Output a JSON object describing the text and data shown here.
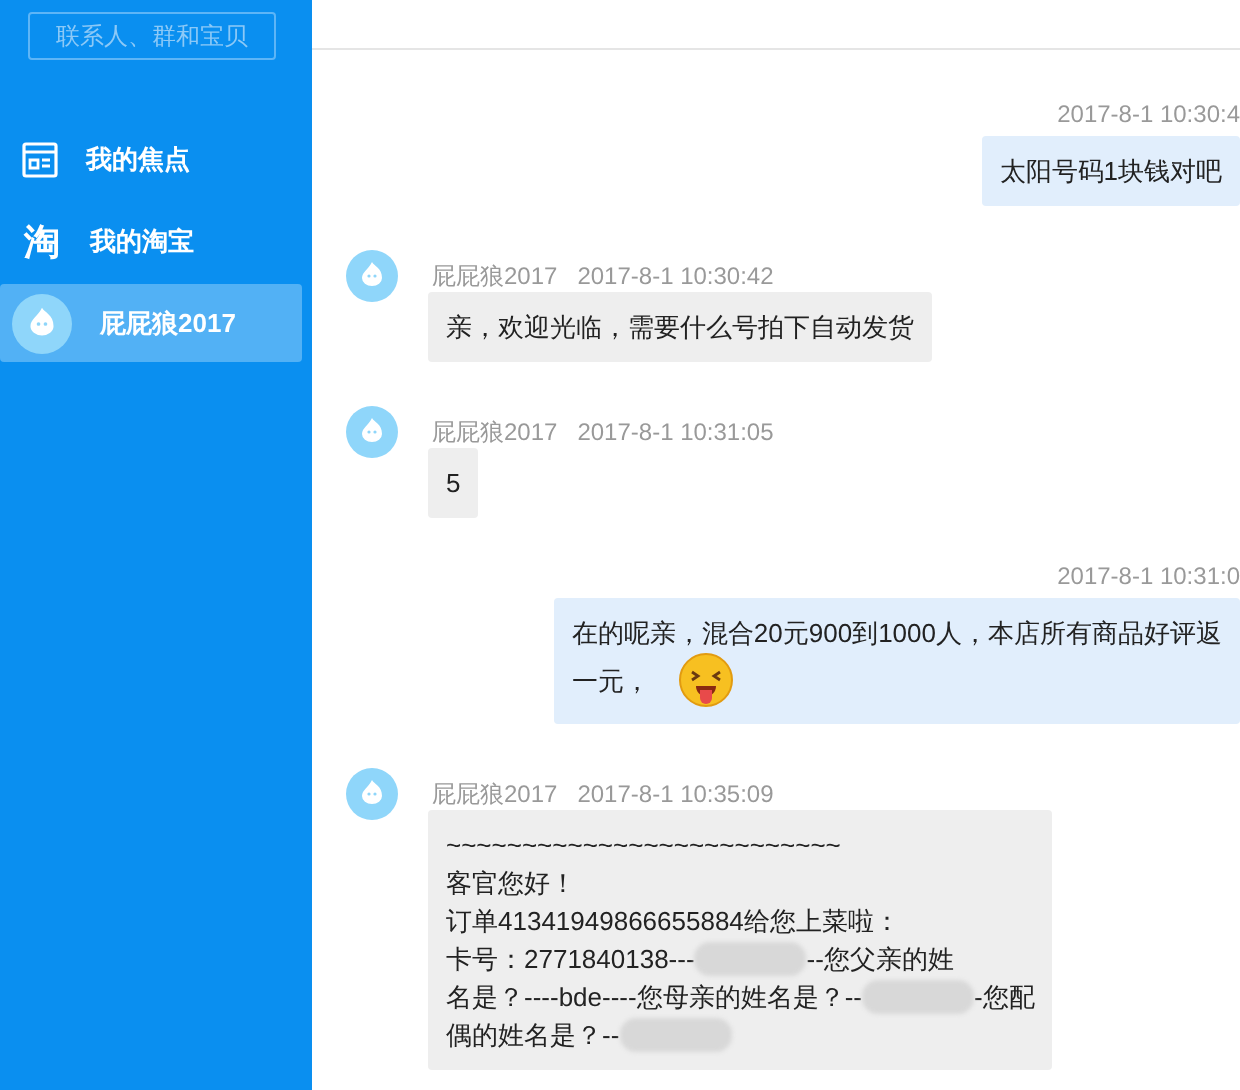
{
  "sidebar": {
    "search": {
      "placeholder": "联系人、群和宝贝"
    },
    "items": [
      {
        "kind": "news",
        "label": "我的焦点",
        "selected": false
      },
      {
        "kind": "taobao",
        "icon_text": "淘",
        "label": "我的淘宝",
        "selected": false
      },
      {
        "kind": "contact",
        "label": "屁屁狼2017",
        "selected": true
      }
    ]
  },
  "messages": [
    {
      "kind": "outgoing",
      "time": "2017-8-1 10:30:4",
      "lines": [
        [
          {
            "kind": "text",
            "text": "太阳号码1块钱对吧"
          }
        ]
      ]
    },
    {
      "kind": "incoming",
      "sender": "屁屁狼2017",
      "time": "2017-8-1 10:30:42",
      "lines": [
        [
          {
            "kind": "text",
            "text": "亲，欢迎光临，需要什么号拍下自动发货"
          }
        ]
      ]
    },
    {
      "kind": "incoming",
      "sender": "屁屁狼2017",
      "time": "2017-8-1 10:31:05",
      "lines": [
        [
          {
            "kind": "text",
            "text": "5"
          }
        ]
      ]
    },
    {
      "kind": "outgoing",
      "time": "2017-8-1 10:31:0",
      "lines": [
        [
          {
            "kind": "text",
            "text": "在的呢亲，混合20元900到1000人，本店所有商品好评返"
          }
        ],
        [
          {
            "kind": "text",
            "text": "一元，"
          },
          {
            "kind": "emoji"
          }
        ]
      ]
    },
    {
      "kind": "incoming",
      "sender": "屁屁狼2017",
      "time": "2017-8-1 10:35:09",
      "lines": [
        [
          {
            "kind": "text",
            "text": "~~~~~~~~~~~~~~~~~~~~~~~~~~"
          }
        ],
        [
          {
            "kind": "text",
            "text": "客官您好！"
          }
        ],
        [
          {
            "kind": "text",
            "text": "订单41341949866655884给您上菜啦："
          }
        ],
        [
          {
            "kind": "text",
            "text": "卡号：2771840138---"
          },
          {
            "kind": "blur"
          },
          {
            "kind": "text",
            "text": "--您父亲的姓"
          }
        ],
        [
          {
            "kind": "text",
            "text": "名是？----bde----您母亲的姓名是？--"
          },
          {
            "kind": "blur"
          },
          {
            "kind": "text",
            "text": "-您配"
          }
        ],
        [
          {
            "kind": "text",
            "text": "偶的姓名是？--"
          },
          {
            "kind": "blur"
          }
        ]
      ]
    }
  ]
}
